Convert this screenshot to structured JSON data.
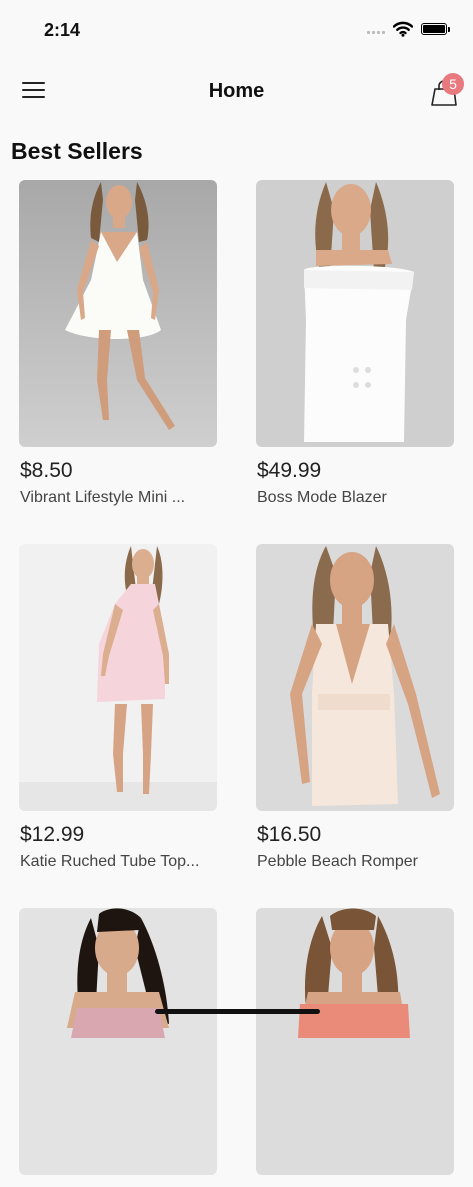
{
  "status_bar": {
    "time": "2:14"
  },
  "nav": {
    "title": "Home",
    "cart_count": "5"
  },
  "section": {
    "title": "Best Sellers"
  },
  "products": [
    {
      "price": "$8.50",
      "name": "Vibrant Lifestyle Mini ..."
    },
    {
      "price": "$49.99",
      "name": "Boss Mode Blazer"
    },
    {
      "price": "$12.99",
      "name": "Katie Ruched Tube Top..."
    },
    {
      "price": "$16.50",
      "name": "Pebble Beach Romper"
    },
    {
      "price": "",
      "name": ""
    },
    {
      "price": "",
      "name": ""
    }
  ],
  "colors": {
    "badge": "#e8797e",
    "background": "#f9f9f9",
    "card_bg": "#d8d8d8"
  }
}
